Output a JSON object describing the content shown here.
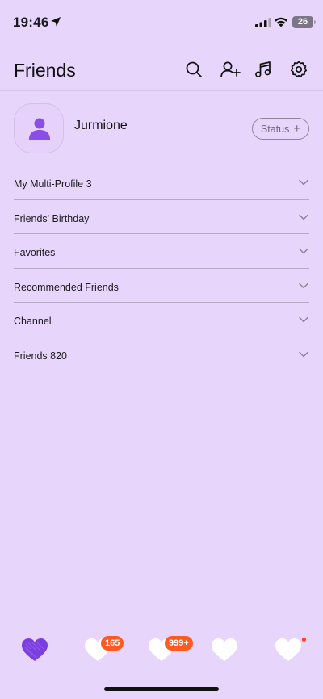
{
  "status_bar": {
    "time": "19:46",
    "battery": "26"
  },
  "header": {
    "title": "Friends"
  },
  "profile": {
    "name": "Jurmione",
    "status_label": "Status",
    "status_plus": "+"
  },
  "sections": [
    {
      "label": "My Multi-Profile 3"
    },
    {
      "label": "Friends' Birthday"
    },
    {
      "label": "Favorites"
    },
    {
      "label": "Recommended Friends"
    },
    {
      "label": "Channel"
    },
    {
      "label": "Friends 820"
    }
  ],
  "tabbar": {
    "badges": {
      "tab2": "165",
      "tab3": "999+"
    },
    "colors": {
      "active": "#7B3FE0",
      "inactive": "#FFFFFF",
      "badge": "#FF5A1F"
    }
  },
  "colors": {
    "background": "#E8D5FB",
    "accent": "#8A4EE6"
  }
}
